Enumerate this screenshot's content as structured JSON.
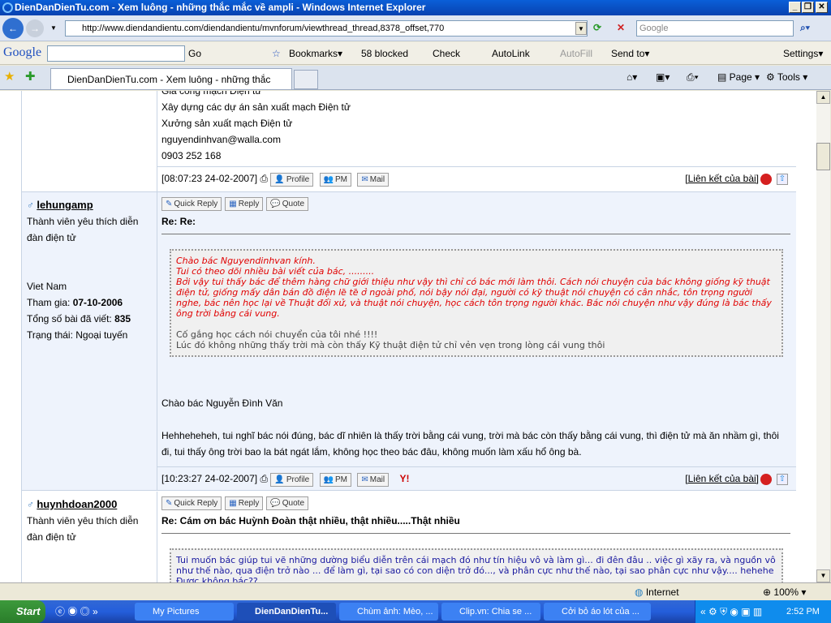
{
  "window": {
    "title": "DienDanDienTu.com - Xem luông - những thắc mắc về ampli - Windows Internet Explorer"
  },
  "nav": {
    "url": "http://www.diendandientu.com/diendandientu/mvnforum/viewthread_thread,8378_offset,770",
    "search_placeholder": "Google"
  },
  "google_toolbar": {
    "logo": "Google",
    "go": "Go",
    "bookmarks": "Bookmarks▾",
    "blocked": "58 blocked",
    "check": "Check",
    "autolink": "AutoLink",
    "autofill": "AutoFill",
    "sendto": "Send to▾",
    "settings": "Settings▾"
  },
  "tabs": {
    "active": "DienDanDienTu.com - Xem luông - những thắc mắc về...",
    "page": "Page",
    "tools": "Tools"
  },
  "posts": [
    {
      "sig_lines": [
        "Gia công mạch Điện tử",
        "Xây dựng các dự án sản xuất mạch Điện tử",
        "Xưởng sản xuất mạch Điện tử",
        "nguyendinhvan@walla.com",
        "0903 252 168"
      ],
      "timestamp": "[08:07:23 24-02-2007]",
      "link": "[Liên kết của bài]"
    },
    {
      "user": "lehungamp",
      "rank": "Thành viên yêu thích diễn đàn điện tử",
      "location": "Viet Nam",
      "joined_label": "Tham gia:",
      "joined": "07-10-2006",
      "posts_label": "Tổng số bài đã viết:",
      "posts": "835",
      "status_label": "Trạng thái:",
      "status": "Ngoại tuyến",
      "title": "Re: Re:",
      "quote_red": [
        "Chào bác Nguyendinhvan kính.",
        "Tui có theo dõi nhiều bài viết của bác, .........",
        "Bởi vậy tui thấy bác để thêm hàng chữ giới thiệu như vậy thì chỉ có bác mới làm thôi. Cách nói chuyện của bác không giống kỹ thuật điện tử, giống mấy dân bán đồ điện lẽ tẽ ở ngoài phố, nói bậy nói đại, người có kỹ thuật nói chuyện có cân nhắc, tôn trọng người nghe, bác nên học lại về Thuật đối xử, và thuật nói chuyện, học cách tôn trọng người khác. Bác nói chuyện như vậy đúng là bác thấy ông trời bằng cái vung."
      ],
      "quote_gray": [
        "Cố gắng học cách nói chuyển của tôi nhé !!!!",
        "Lúc đó không những thấy trời mà còn thấy Kỹ thuật điện tử chỉ vẻn vẹn trong lòng cái vung thôi"
      ],
      "body": [
        "Chào bác Nguyễn Đình Văn",
        "Hehheheheh, tui nghĩ bác nói đúng, bác dĩ nhiên là thấy trời bằng cái vung, trời mà bác còn thấy bằng cái vung, thì điện tử mà ăn nhầm gì, thôi đi, tui thấy ông trời bao la bát ngát lắm, không học theo bác đâu, không muốn làm xấu hổ ông bà."
      ],
      "timestamp": "[10:23:27 24-02-2007]",
      "link": "[Liên kết của bài]"
    },
    {
      "user": "huynhdoan2000",
      "rank": "Thành viên yêu thích diễn đàn điện tử",
      "title": "Re: Cám ơn bác Huỳnh Đoàn thật nhiều, thật nhiều.....Thật nhiều",
      "quote_blue": "Tui muốn bác giúp tui vẽ những dường biểu diễn trên cái mạch đó như tín hiệu vô và làm gì... đi đên đâu .. việc gì xãy ra, và nguồn vô như thế nào, qua điện trở nào ... để làm gì, tại sao có con diện trở đó..., và phân cực như thế nào, tại sao phân cực như vậy.... hehehe Được không bác??"
    }
  ],
  "buttons": {
    "quick_reply": "Quick Reply",
    "reply": "Reply",
    "quote": "Quote",
    "profile": "Profile",
    "pm": "PM",
    "mail": "Mail"
  },
  "status": {
    "zone": "Internet",
    "zoom": "100%"
  },
  "taskbar": {
    "start": "Start",
    "items": [
      "My Pictures",
      "DienDanDienTu...",
      "Chùm ảnh: Mèo, ...",
      "Clip.vn: Chia se ...",
      "Cởi bỏ áo lót của ..."
    ],
    "clock": "2:52 PM"
  }
}
